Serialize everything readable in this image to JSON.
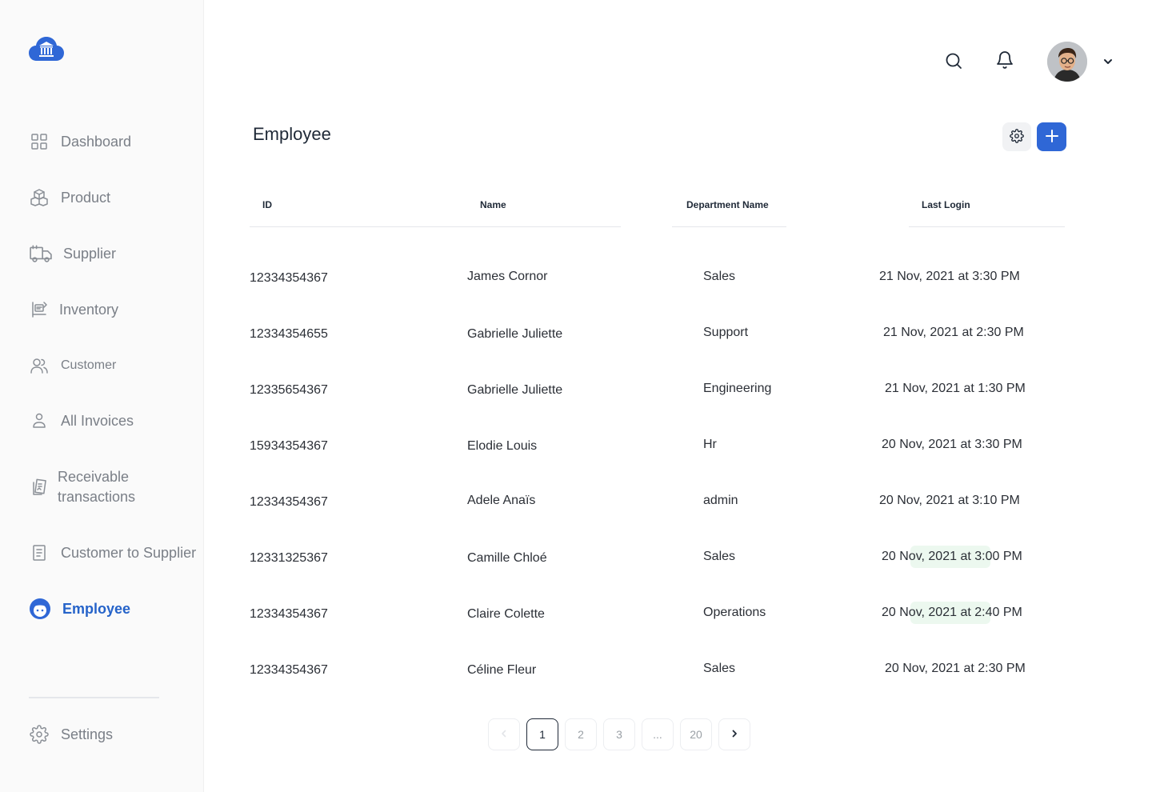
{
  "sidebar": {
    "items": [
      {
        "label": "Dashboard",
        "icon": "grid-icon"
      },
      {
        "label": "Product",
        "icon": "boxes-icon"
      },
      {
        "label": "Supplier",
        "icon": "truck-icon"
      },
      {
        "label": "Inventory",
        "icon": "inventory-icon"
      },
      {
        "label": "Customer",
        "icon": "users-icon"
      },
      {
        "label": "All Invoices",
        "icon": "user-icon"
      },
      {
        "label_line1": "Receivable",
        "label_line2": "transactions",
        "icon": "receipt-icon"
      },
      {
        "label": "Customer to Supplier",
        "icon": "document-icon"
      },
      {
        "label": "Employee",
        "icon": "employee-icon",
        "active": true
      }
    ],
    "settings_label": "Settings"
  },
  "main": {
    "title": "Employee",
    "columns": {
      "id": "ID",
      "name": "Name",
      "department": "Department Name",
      "last_login": "Last Login"
    },
    "rows": [
      {
        "id": "12334354367",
        "name": "James Cornor",
        "department": "Sales",
        "last_login": "21 Nov, 2021 at 3:30 PM"
      },
      {
        "id": "12334354655",
        "name": "Gabrielle Juliette",
        "department": "Support",
        "last_login": "21 Nov, 2021 at 2:30 PM"
      },
      {
        "id": "12335654367",
        "name": "Gabrielle Juliette",
        "department": "Engineering",
        "last_login": "21 Nov, 2021 at 1:30 PM"
      },
      {
        "id": "15934354367",
        "name": "Elodie Louis",
        "department": "Hr",
        "last_login": "20 Nov, 2021 at 3:30 PM"
      },
      {
        "id": "12334354367",
        "name": "Adele Anaïs",
        "department": "admin",
        "last_login": "20 Nov, 2021 at 3:10 PM"
      },
      {
        "id": "12331325367",
        "name": "Camille Chloé",
        "department": "Sales",
        "last_login": "20 Nov, 2021 at 3:00 PM"
      },
      {
        "id": "12334354367",
        "name": "Claire Colette",
        "department": "Operations",
        "last_login": "20 Nov, 2021 at 2:40 PM"
      },
      {
        "id": "12334354367",
        "name": "Céline Fleur",
        "department": "Sales",
        "last_login": "20 Nov, 2021 at 2:30 PM"
      }
    ],
    "pagination": {
      "pages": [
        "1",
        "2",
        "3",
        "...",
        "20"
      ],
      "current": "1"
    }
  },
  "colors": {
    "accent": "#2f67d6",
    "active_nav": "#2563c9",
    "highlight": "#ecf8ef"
  }
}
